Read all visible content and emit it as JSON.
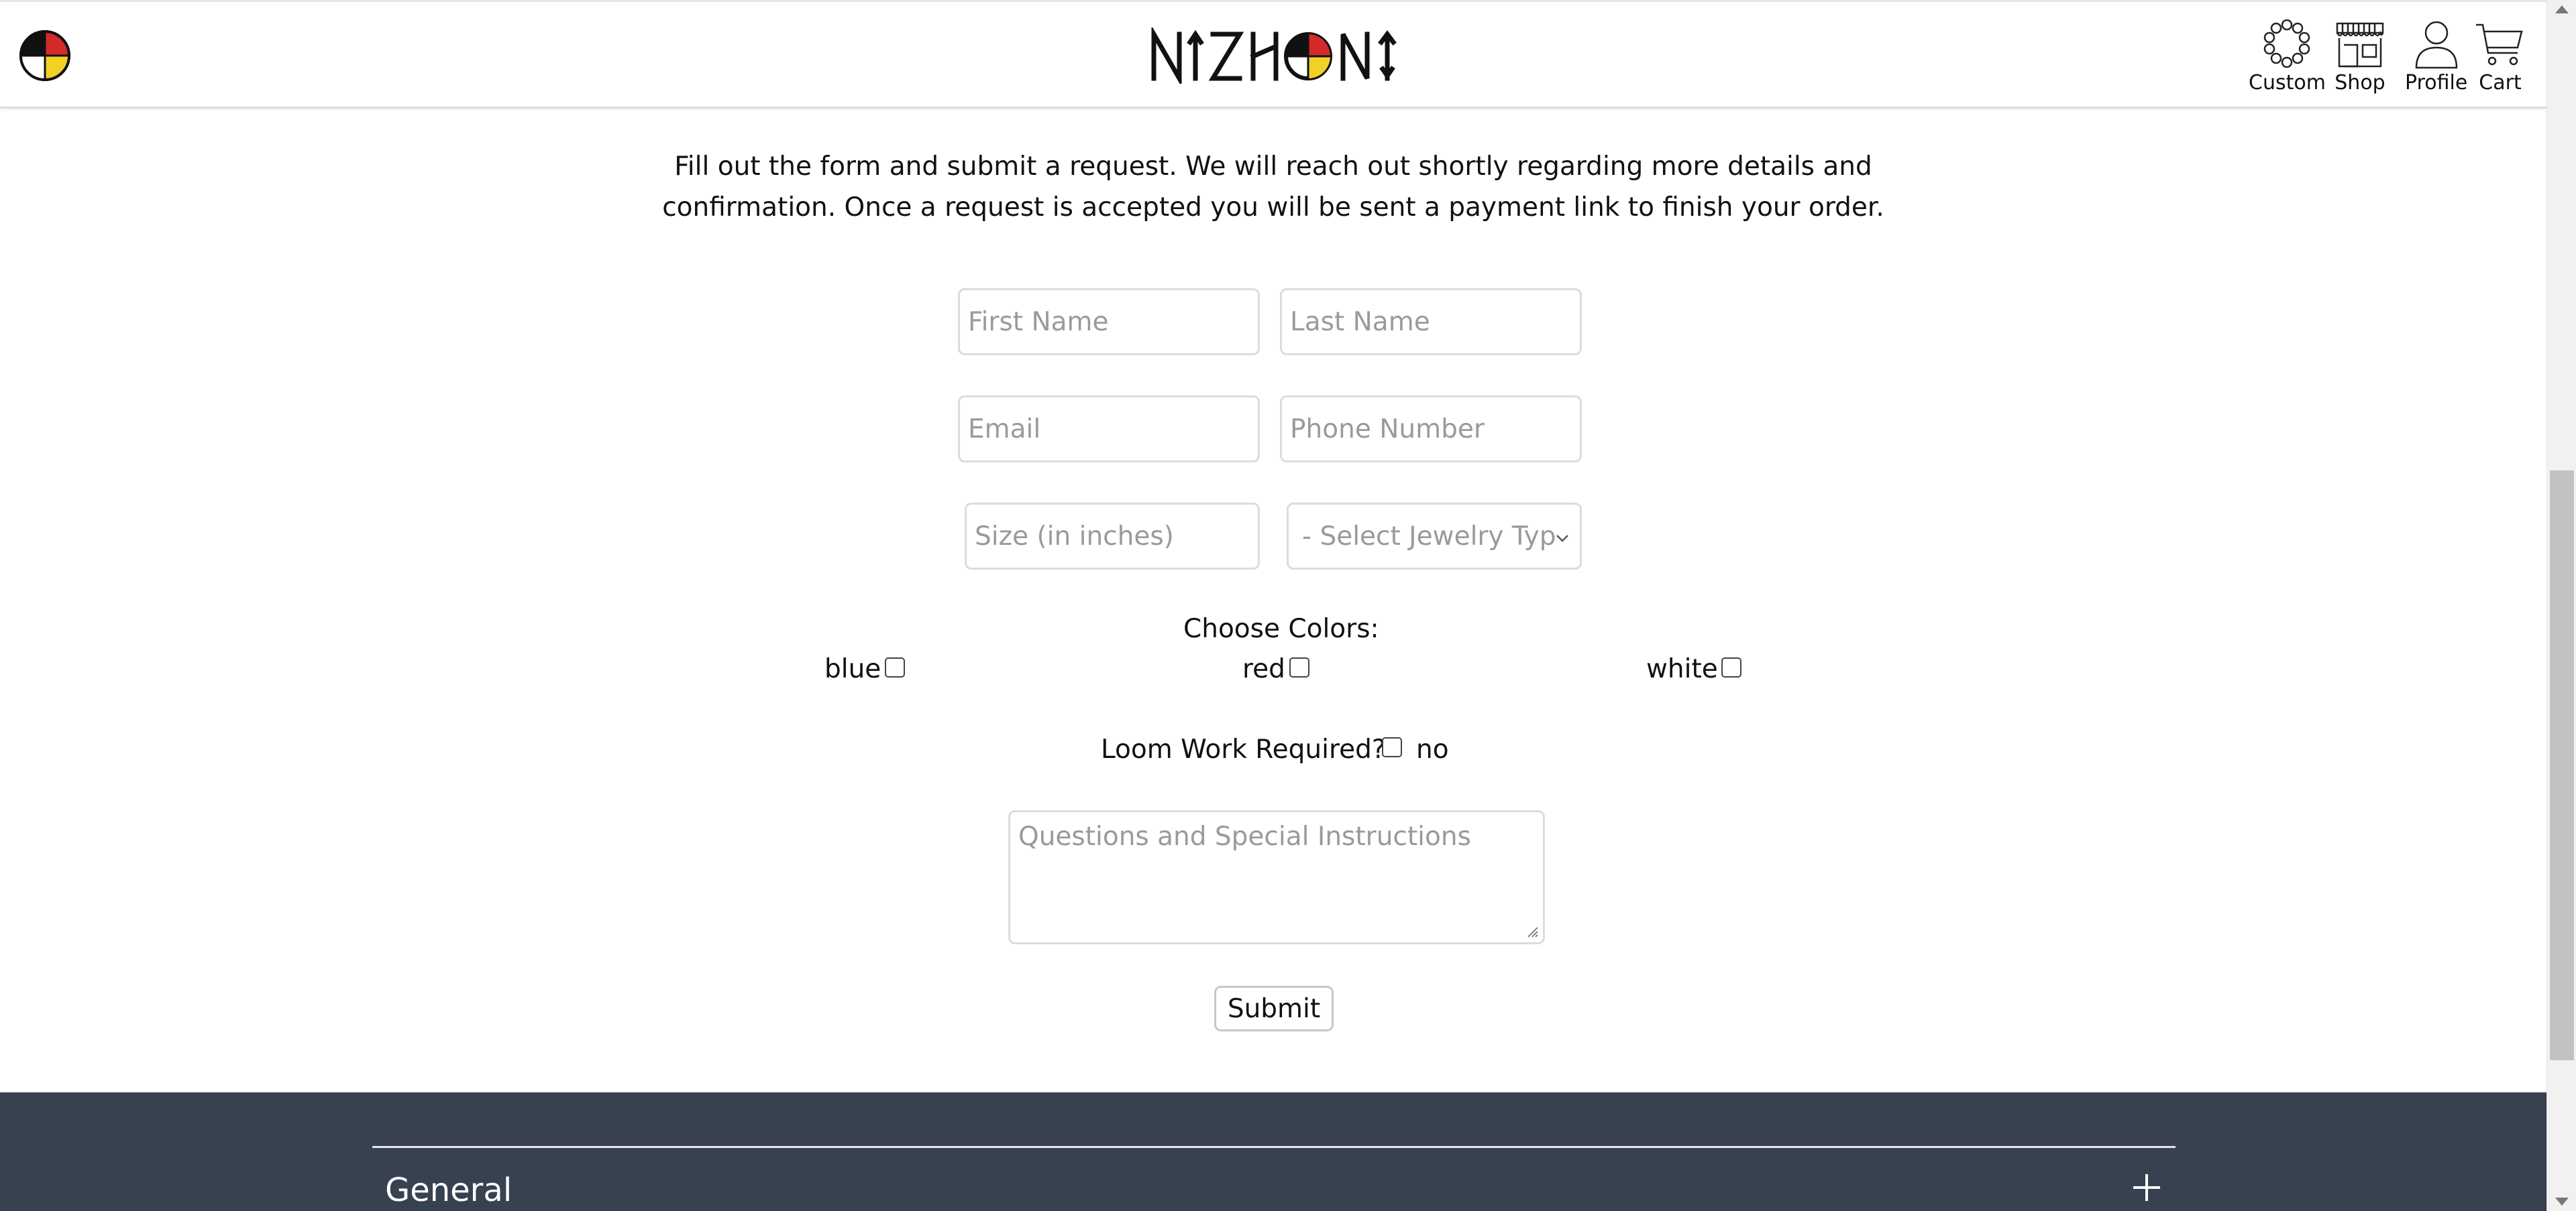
{
  "header": {
    "nav": [
      {
        "label": "Custom",
        "icon": "beads-icon"
      },
      {
        "label": "Shop",
        "icon": "storefront-icon"
      },
      {
        "label": "Profile",
        "icon": "user-icon"
      },
      {
        "label": "Cart",
        "icon": "cart-icon"
      }
    ]
  },
  "intro": {
    "line1": "Fill out the form and submit a request. We will reach out shortly regarding more details and",
    "line2": "confirmation. Once a request is accepted you will be sent a payment link to finish your order."
  },
  "form": {
    "first_name_placeholder": "First Name",
    "last_name_placeholder": "Last Name",
    "email_placeholder": "Email",
    "phone_placeholder": "Phone Number",
    "size_placeholder": "Size (in inches)",
    "jewelry_type_selected": "- Select Jewelry Typ",
    "colors_label": "Choose Colors:",
    "colors": [
      "blue",
      "red",
      "white"
    ],
    "loom_label": "Loom Work Required?",
    "loom_option": "no",
    "instructions_placeholder": "Questions and Special Instructions",
    "submit_label": "Submit"
  },
  "footer": {
    "section_title": "General"
  },
  "colors": {
    "footer_bg": "#374150",
    "wheel_red": "#d42a2a",
    "wheel_yellow": "#f2d125",
    "wheel_black": "#111111",
    "wheel_white": "#ffffff"
  }
}
